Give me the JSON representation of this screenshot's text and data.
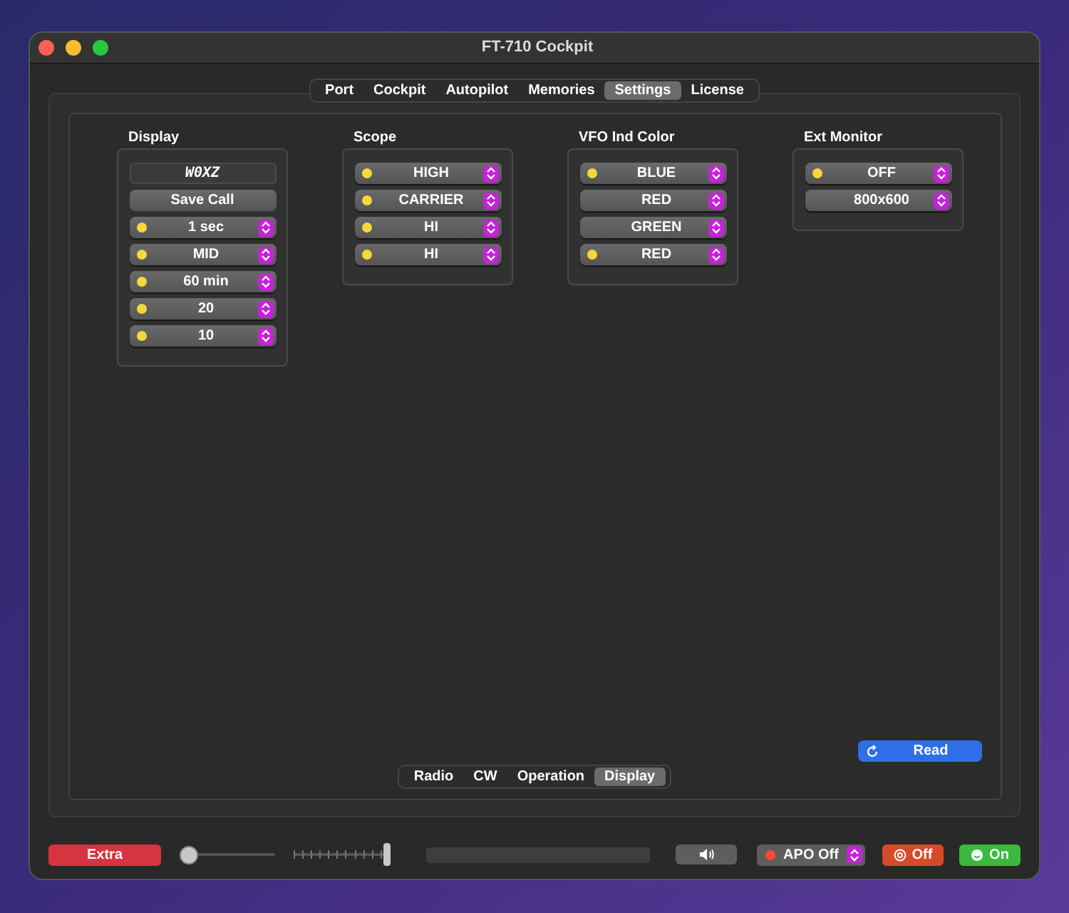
{
  "window": {
    "title": "FT-710 Cockpit"
  },
  "tabs": [
    {
      "label": "Port",
      "selected": false
    },
    {
      "label": "Cockpit",
      "selected": false
    },
    {
      "label": "Autopilot",
      "selected": false
    },
    {
      "label": "Memories",
      "selected": false
    },
    {
      "label": "Settings",
      "selected": true
    },
    {
      "label": "License",
      "selected": false
    }
  ],
  "groups": [
    {
      "title": "Display",
      "call_field": {
        "value": "W0XZ"
      },
      "save_button": "Save Call",
      "popups": [
        {
          "value": "1 sec",
          "indicator": true
        },
        {
          "value": "MID",
          "indicator": true
        },
        {
          "value": "60 min",
          "indicator": true
        },
        {
          "value": "20",
          "indicator": true
        },
        {
          "value": "10",
          "indicator": true
        }
      ]
    },
    {
      "title": "Scope",
      "popups": [
        {
          "value": "HIGH",
          "indicator": true
        },
        {
          "value": "CARRIER",
          "indicator": true
        },
        {
          "value": "HI",
          "indicator": true
        },
        {
          "value": "HI",
          "indicator": true
        }
      ]
    },
    {
      "title": "VFO Ind Color",
      "popups": [
        {
          "value": "BLUE",
          "indicator": true
        },
        {
          "value": "RED",
          "indicator": false
        },
        {
          "value": "GREEN",
          "indicator": false
        },
        {
          "value": "RED",
          "indicator": true
        }
      ]
    },
    {
      "title": "Ext Monitor",
      "popups": [
        {
          "value": "OFF",
          "indicator": true
        },
        {
          "value": "800x600",
          "indicator": false
        }
      ]
    }
  ],
  "read_button": "Read",
  "sub_tabs": [
    {
      "label": "Radio",
      "selected": false
    },
    {
      "label": "CW",
      "selected": false
    },
    {
      "label": "Operation",
      "selected": false
    },
    {
      "label": "Display",
      "selected": true
    }
  ],
  "bottom_bar": {
    "extra_button": "Extra",
    "volume_slider": {
      "level": 0
    },
    "step_slider": {
      "level": 1
    },
    "apo_popup": {
      "value": "APO Off"
    },
    "off_button": "Off",
    "on_button": "On"
  }
}
